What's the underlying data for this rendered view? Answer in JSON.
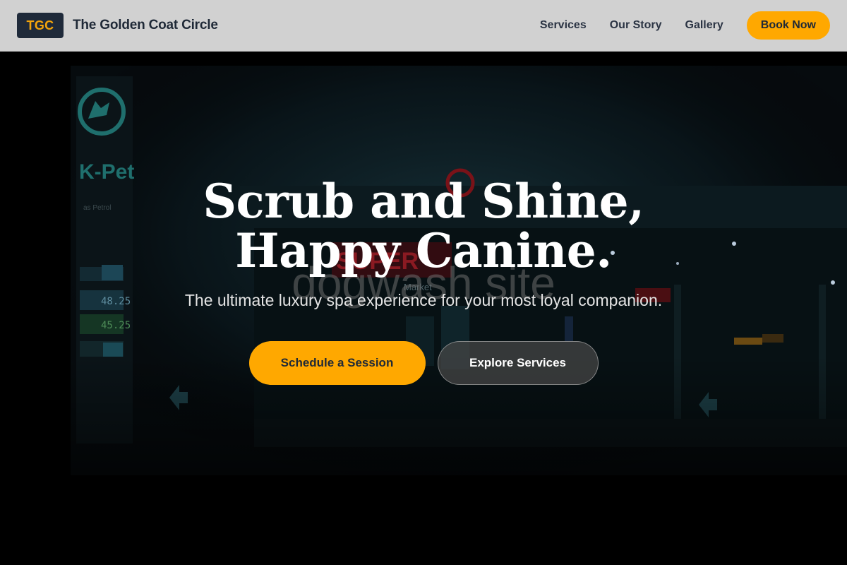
{
  "header": {
    "logo_text": "TGC",
    "brand_name": "The Golden Coat Circle",
    "nav": [
      "Services",
      "Our Story",
      "Gallery"
    ],
    "book_label": "Book Now"
  },
  "hero": {
    "title": "Scrub and Shine, Happy Canine.",
    "subtitle": "The ultimate luxury spa experience for your most loyal companion.",
    "primary_cta": "Schedule a Session",
    "secondary_cta": "Explore Services",
    "background": {
      "sign_text": "K-Pet",
      "sign_subtext": "as Petrol",
      "watermark": "dogwash site",
      "storefront_text": "SUPER",
      "market_text": "Market",
      "price_1": "48.25",
      "price_2": "45.25"
    }
  },
  "colors": {
    "accent": "#ffa800",
    "header_bg": "#d1d1d1",
    "logo_bg": "#1f2a3a",
    "hero_bg": "#000000",
    "text_dark": "#1f2937"
  }
}
